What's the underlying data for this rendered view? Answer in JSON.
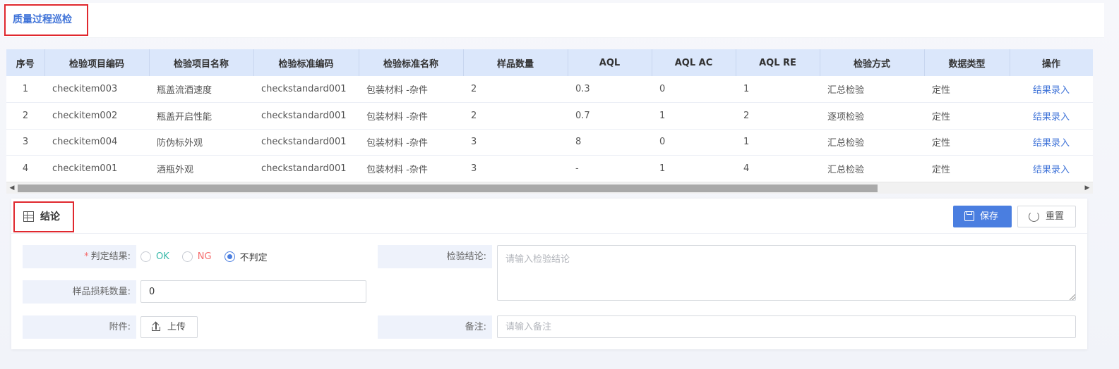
{
  "page": {
    "title": "质量过程巡检"
  },
  "table": {
    "columns": [
      "序号",
      "检验项目编码",
      "检验项目名称",
      "检验标准编码",
      "检验标准名称",
      "样品数量",
      "AQL",
      "AQL AC",
      "AQL RE",
      "检验方式",
      "数据类型",
      "操作"
    ],
    "rows": [
      {
        "idx": "1",
        "item_code": "checkitem003",
        "item_name": "瓶盖流酒速度",
        "std_code": "checkstandard001",
        "std_name": "包装材料 -杂件",
        "sample_qty": "2",
        "aql": "0.3",
        "aql_ac": "0",
        "aql_re": "1",
        "method": "汇总检验",
        "data_type": "定性",
        "action": "结果录入"
      },
      {
        "idx": "2",
        "item_code": "checkitem002",
        "item_name": "瓶盖开启性能",
        "std_code": "checkstandard001",
        "std_name": "包装材料 -杂件",
        "sample_qty": "2",
        "aql": "0.7",
        "aql_ac": "1",
        "aql_re": "2",
        "method": "逐项检验",
        "data_type": "定性",
        "action": "结果录入"
      },
      {
        "idx": "3",
        "item_code": "checkitem004",
        "item_name": "防伪标外观",
        "std_code": "checkstandard001",
        "std_name": "包装材料 -杂件",
        "sample_qty": "3",
        "aql": "8",
        "aql_ac": "0",
        "aql_re": "1",
        "method": "汇总检验",
        "data_type": "定性",
        "action": "结果录入"
      },
      {
        "idx": "4",
        "item_code": "checkitem001",
        "item_name": "酒瓶外观",
        "std_code": "checkstandard001",
        "std_name": "包装材料 -杂件",
        "sample_qty": "3",
        "aql": "-",
        "aql_ac": "1",
        "aql_re": "4",
        "method": "汇总检验",
        "data_type": "定性",
        "action": "结果录入"
      }
    ]
  },
  "conclusion": {
    "title": "结论",
    "save_label": "保存",
    "reset_label": "重置",
    "judge_label": "判定结果:",
    "judge_required_mark": "*",
    "options": {
      "ok": "OK",
      "ng": "NG",
      "none": "不判定"
    },
    "judge_selected": "不判定",
    "sample_loss_label": "样品损耗数量:",
    "sample_loss_value": "0",
    "attachment_label": "附件:",
    "upload_label": "上传",
    "inspect_conclusion_label": "检验结论:",
    "inspect_conclusion_placeholder": "请输入检验结论",
    "remark_label": "备注:",
    "remark_placeholder": "请输入备注"
  },
  "colors": {
    "accent": "#4a7ee0",
    "ok": "#36b8a8",
    "ng": "#f56c6c",
    "header_bg": "#dbe7fb",
    "highlight_border": "#e0282e"
  }
}
